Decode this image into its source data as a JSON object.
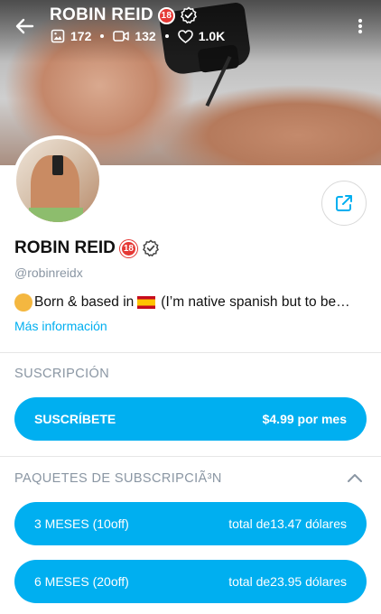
{
  "header": {
    "title": "ROBIN REID",
    "adult_badge": "18",
    "stats": {
      "photos": "172",
      "videos": "132",
      "likes": "1.0K"
    }
  },
  "profile": {
    "name": "ROBIN REID",
    "adult_badge": "18",
    "username": "@robinreidx",
    "bio_before_flag": "Born & based in",
    "bio_after_flag": " (I’m native spanish but to be…",
    "more_info": "Más información"
  },
  "subscription": {
    "section_title": "SUSCRIPCIÓN",
    "button_label": "SUSCRÍBETE",
    "button_price": "$4.99 por mes"
  },
  "bundles": {
    "section_title": "PAQUETES DE SUBSCRIPCIÃ³N",
    "items": [
      {
        "label": "3 MESES (10off)",
        "price": "total de13.47 dólares"
      },
      {
        "label": "6 MESES (20off)",
        "price": "total de23.95 dólares"
      }
    ]
  },
  "colors": {
    "accent": "#00aff0",
    "muted_text": "#8a96a3",
    "adult_badge": "#e53935"
  },
  "icons": [
    "back-arrow-icon",
    "image-icon",
    "video-icon",
    "heart-icon",
    "more-vertical-icon",
    "share-icon",
    "verified-icon",
    "chevron-up-icon"
  ]
}
